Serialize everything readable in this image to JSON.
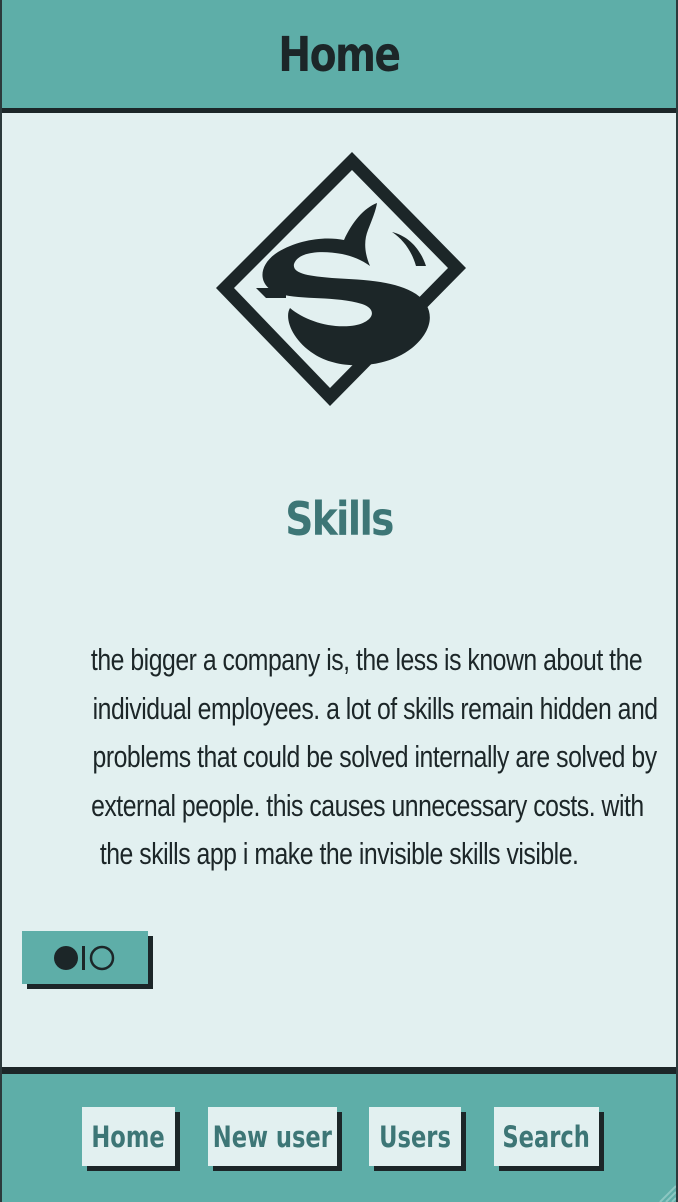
{
  "header": {
    "title": "Home"
  },
  "main": {
    "logo_icon": "skills-s-diamond-logo",
    "app_title": "Skills",
    "description_lines": [
      "the bigger a company is, the less is known about the",
      "individual employees. a lot of skills remain hidden and",
      "problems that could be solved internally are solved by",
      "external people. this causes unnecessary costs. with",
      "the skills app i make the invisible skills visible."
    ],
    "toggle": {
      "icon": "toggle-switch-icon"
    }
  },
  "footer": {
    "nav": [
      {
        "label": "Home"
      },
      {
        "label": "New user"
      },
      {
        "label": "Users"
      },
      {
        "label": "Search"
      }
    ]
  },
  "colors": {
    "teal": "#5eaea8",
    "background": "#e2f0f0",
    "dark": "#1c2628",
    "title_teal": "#3d7676"
  }
}
